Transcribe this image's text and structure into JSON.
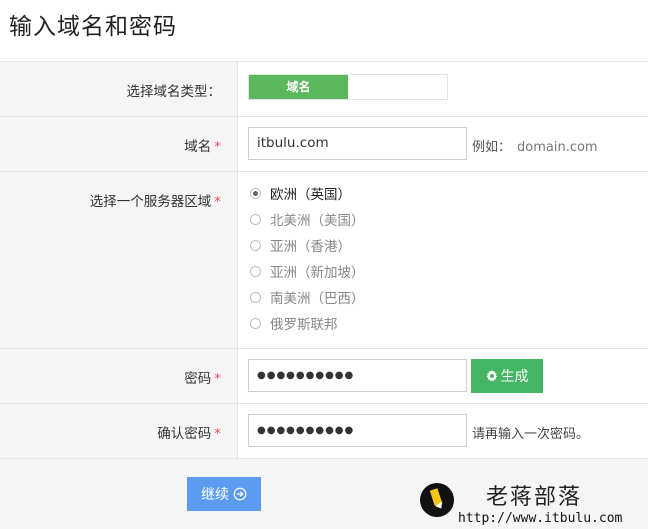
{
  "page": {
    "title": "输入域名和密码"
  },
  "form": {
    "domain_type": {
      "label": "选择域名类型：",
      "option": "域名"
    },
    "domain": {
      "label": "域名",
      "required": "*",
      "value": "itbulu.com",
      "hint_prefix": "例如：",
      "hint_example": "domain.com"
    },
    "region": {
      "label": "选择一个服务器区域",
      "required": "*",
      "options": [
        {
          "label": "欧洲（英国）",
          "checked": true
        },
        {
          "label": "北美洲（美国）",
          "checked": false
        },
        {
          "label": "亚洲（香港）",
          "checked": false
        },
        {
          "label": "亚洲（新加坡）",
          "checked": false
        },
        {
          "label": "南美洲（巴西）",
          "checked": false
        },
        {
          "label": "俄罗斯联邦",
          "checked": false
        }
      ]
    },
    "password": {
      "label": "密码",
      "required": "*",
      "value": "●●●●●●●●●●",
      "generate_label": "生成",
      "generate_icon": "gear-icon"
    },
    "confirm": {
      "label": "确认密码",
      "required": "*",
      "value": "●●●●●●●●●●",
      "hint": "请再输入一次密码。"
    }
  },
  "footer": {
    "submit_label": "继续",
    "submit_icon": "arrow-right-circle-icon"
  },
  "watermark": {
    "name": "老蒋部落",
    "url": "http://www.itbulu.com"
  },
  "colors": {
    "green": "#5cb85c",
    "generate_green": "#43b563",
    "submit_blue": "#5b9cf0",
    "required_red": "#e15353"
  }
}
